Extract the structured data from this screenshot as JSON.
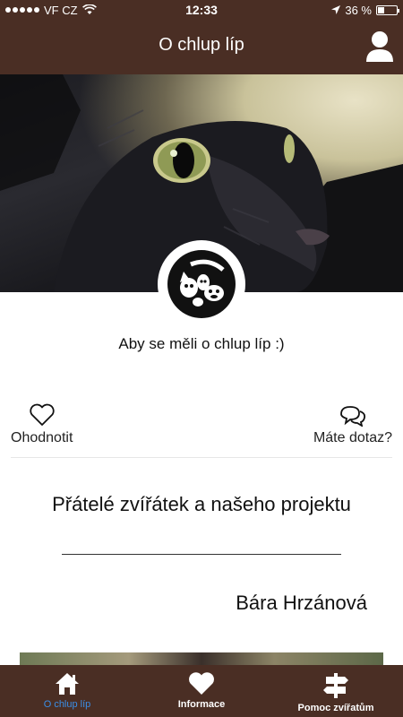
{
  "status_bar": {
    "carrier": "VF CZ",
    "time": "12:33",
    "battery_percent": "36 %",
    "battery_level": 0.36,
    "icons": [
      "signal-dots-icon",
      "wifi-icon",
      "location-arrow-icon",
      "battery-icon"
    ]
  },
  "header": {
    "title": "O chlup líp",
    "profile_icon": "user-icon"
  },
  "hero": {
    "image": "black-cat-photo"
  },
  "profile": {
    "logo": "animals-logo",
    "tagline": "Aby se měli o chlup líp :)"
  },
  "actions": {
    "rate_label": "Ohodnotit",
    "rate_icon": "heart-outline-icon",
    "question_label": "Máte dotaz?",
    "question_icon": "chat-bubbles-icon"
  },
  "friends": {
    "heading": "Přátelé zvířátek a našeho projektu",
    "first_name": "Bára Hrzánová"
  },
  "tab_bar": {
    "tabs": [
      {
        "label": "O chlup líp",
        "icon": "home-icon",
        "active": true
      },
      {
        "label": "Informace",
        "icon": "heart-icon",
        "active": false
      },
      {
        "label": "Pomoc zvířatům",
        "icon": "signpost-icon",
        "active": false
      }
    ]
  },
  "colors": {
    "brand_brown": "#4a2e24",
    "active_tab": "#3a8ee6"
  }
}
